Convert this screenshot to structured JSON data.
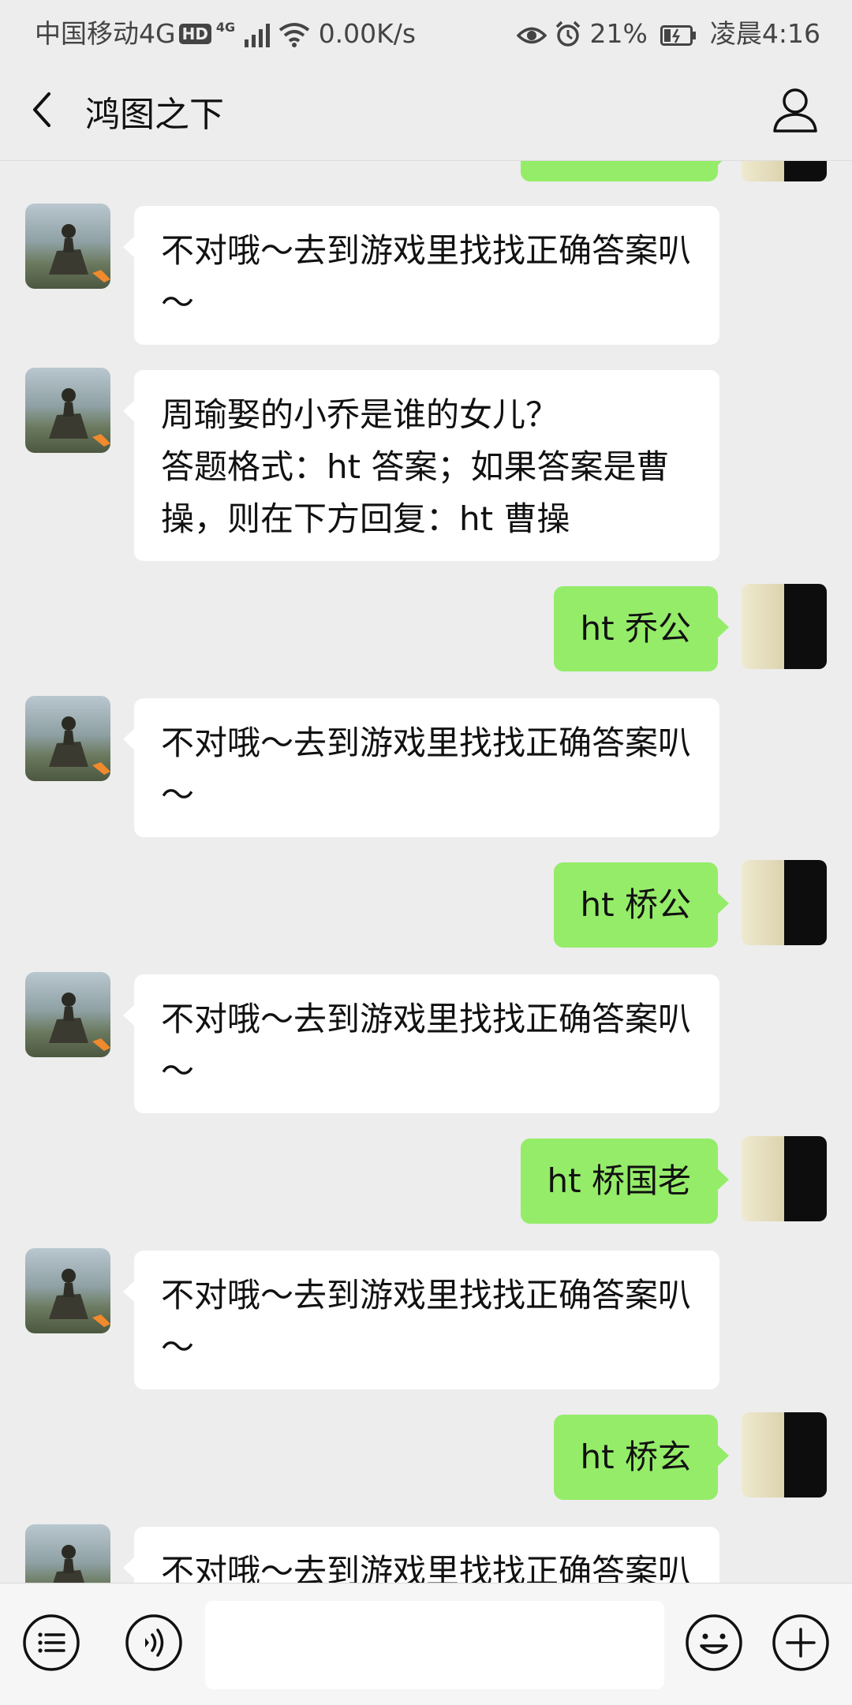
{
  "status_bar": {
    "carrier": "中国移动4G",
    "hd_badge": "HD",
    "network_badge": "4G",
    "speed": "0.00K/s",
    "battery": "21%",
    "time": "凌晨4:16"
  },
  "header": {
    "title": "鸿图之下"
  },
  "messages": [
    {
      "side": "left",
      "text": "不对哦～去到游戏里找找正确答案叭～"
    },
    {
      "side": "left",
      "text": "周瑜娶的小乔是谁的女儿？\n答题格式：ht 答案；如果答案是曹操，则在下方回复：ht 曹操"
    },
    {
      "side": "right",
      "text": "ht 乔公"
    },
    {
      "side": "left",
      "text": "不对哦～去到游戏里找找正确答案叭～"
    },
    {
      "side": "right",
      "text": "ht 桥公"
    },
    {
      "side": "left",
      "text": "不对哦～去到游戏里找找正确答案叭～"
    },
    {
      "side": "right",
      "text": "ht 桥国老"
    },
    {
      "side": "left",
      "text": "不对哦～去到游戏里找找正确答案叭～"
    },
    {
      "side": "right",
      "text": "ht 桥玄"
    },
    {
      "side": "left",
      "text": "不对哦～去到游戏里找找正确答案叭～"
    }
  ],
  "input_bar": {
    "icons": [
      "menu-list-icon",
      "voice-icon",
      "emoji-icon",
      "plus-icon"
    ],
    "input_value": ""
  },
  "colors": {
    "background": "#ededed",
    "bubble_right": "#95ec69",
    "bubble_left": "#ffffff"
  }
}
